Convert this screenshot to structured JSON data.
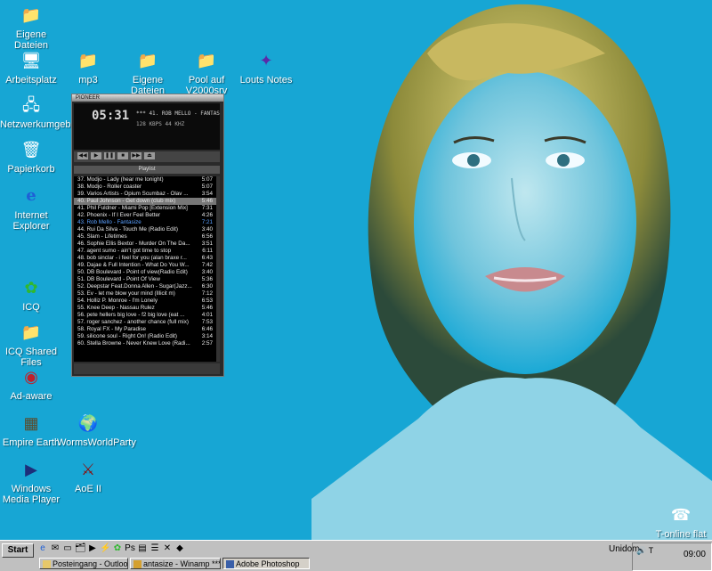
{
  "desktop_icons": [
    {
      "label": "Eigene Dateien",
      "icon": "folder-icon",
      "glyph": "📁"
    },
    {
      "label": "Arbeitsplatz",
      "icon": "computer-icon",
      "glyph": "🖥"
    },
    {
      "label": "Netzwerkumgebung",
      "icon": "network-icon",
      "glyph": "🖧"
    },
    {
      "label": "Papierkorb",
      "icon": "recycle-bin-icon",
      "glyph": "🗑"
    },
    {
      "label": "Internet Explorer",
      "icon": "ie-icon",
      "glyph": "e"
    },
    {
      "label": "ICQ",
      "icon": "icq-flower-icon",
      "glyph": "✿"
    },
    {
      "label": "ICQ Shared Files",
      "icon": "shared-folder-icon",
      "glyph": "📁"
    },
    {
      "label": "Ad-aware",
      "icon": "adaware-icon",
      "glyph": "◉"
    },
    {
      "label": "Empire Earth",
      "icon": "empire-earth-icon",
      "glyph": "▦"
    },
    {
      "label": "Windows Media Player",
      "icon": "media-player-icon",
      "glyph": "▶"
    },
    {
      "label": "mp3",
      "icon": "folder-icon",
      "glyph": "📁"
    },
    {
      "label": "Eigene Dateien",
      "icon": "folder-icon",
      "glyph": "📁"
    },
    {
      "label": "Pool auf V2000srv",
      "icon": "network-folder-icon",
      "glyph": "📁"
    },
    {
      "label": "Louts Notes",
      "icon": "lotus-notes-icon",
      "glyph": "✦"
    },
    {
      "label": "WormsWorldParty",
      "icon": "worms-icon",
      "glyph": "🌍"
    },
    {
      "label": "AoE II",
      "icon": "aoe-icon",
      "glyph": "⚔"
    },
    {
      "label": "T-online flat",
      "icon": "dialup-icon",
      "glyph": "☎"
    }
  ],
  "winamp": {
    "time": "05:31",
    "ticker": "*** 41. ROB MELLO - FANTAS",
    "bitrate": "128 KBPS  44 KHZ",
    "playlist_title": "Playlist",
    "tracks": [
      {
        "title": "37. Modjo - Lady (hear me tonight)",
        "dur": "5:07"
      },
      {
        "title": "38. Modjo - Roller coaster",
        "dur": "5:07"
      },
      {
        "title": "39. Varios Artists - Opium Scumbaz - Olav ...",
        "dur": "3:54"
      },
      {
        "title": "40. Paul Johnson - Get down (club mix)",
        "dur": "5:46"
      },
      {
        "title": "41. Phil Fuldner - Miami Pop [Extension Mix]",
        "dur": "7:31"
      },
      {
        "title": "42. Phoenix - If I Ever Feel Better",
        "dur": "4:26"
      },
      {
        "title": "43. Rob Mello - Fantasize",
        "dur": "7:21"
      },
      {
        "title": "44. Rui Da Silva - Touch Me (Radio Edit)",
        "dur": "3:40"
      },
      {
        "title": "45. Slam - Lifetimes",
        "dur": "6:56"
      },
      {
        "title": "46. Sophie Ellis Bextor - Murder On The Da...",
        "dur": "3:51"
      },
      {
        "title": "47. agent sumo - ain't got time to stop",
        "dur": "6:11"
      },
      {
        "title": "48. bob sinclar - i feel for you (alan braxe r...",
        "dur": "6:43"
      },
      {
        "title": "49. Dajae & Full Intention - What Do You W...",
        "dur": "7:42"
      },
      {
        "title": "50. DB Boulevard - Point of view(Radio Edit)",
        "dur": "3:40"
      },
      {
        "title": "51. DB Boulevard - Point Of View",
        "dur": "5:36"
      },
      {
        "title": "52. Deepstar Feat.Donna Allen - Sugar(Jazz...",
        "dur": "6:30"
      },
      {
        "title": "53. Ev - let me blow your mind (Illicit m)",
        "dur": "7:12"
      },
      {
        "title": "54. Holliz P. Monroe - I'm Lonely",
        "dur": "6:53"
      },
      {
        "title": "55. Knee Deep - Nassau Rulez",
        "dur": "5:46"
      },
      {
        "title": "56. pete hellers big love - f2 big love (eat ...",
        "dur": "4:01"
      },
      {
        "title": "57. roger sanchez - another chance (full mix)",
        "dur": "7:53"
      },
      {
        "title": "58. Royal FX - My Paradise",
        "dur": "6:46"
      },
      {
        "title": "59. silicone soul - Right On! (Radio Edit)",
        "dur": "3:14"
      },
      {
        "title": "60. Stella Browne - Never Knew Love (Radi...",
        "dur": "2:57"
      }
    ],
    "selected_index": 3,
    "current_index": 6
  },
  "taskbar": {
    "start_label": "Start",
    "unidom_label": "Unidom",
    "clock": "09:00",
    "tasks": [
      {
        "label": "Posteingang - Outlook Ex...",
        "icon": "outlook-icon"
      },
      {
        "label": "antasize - Winamp *** 43...",
        "icon": "winamp-icon"
      },
      {
        "label": "Adobe Photoshop",
        "icon": "photoshop-icon"
      }
    ]
  },
  "colors": {
    "desktop": "#17a6d4",
    "taskbar": "#c0c0c0"
  }
}
